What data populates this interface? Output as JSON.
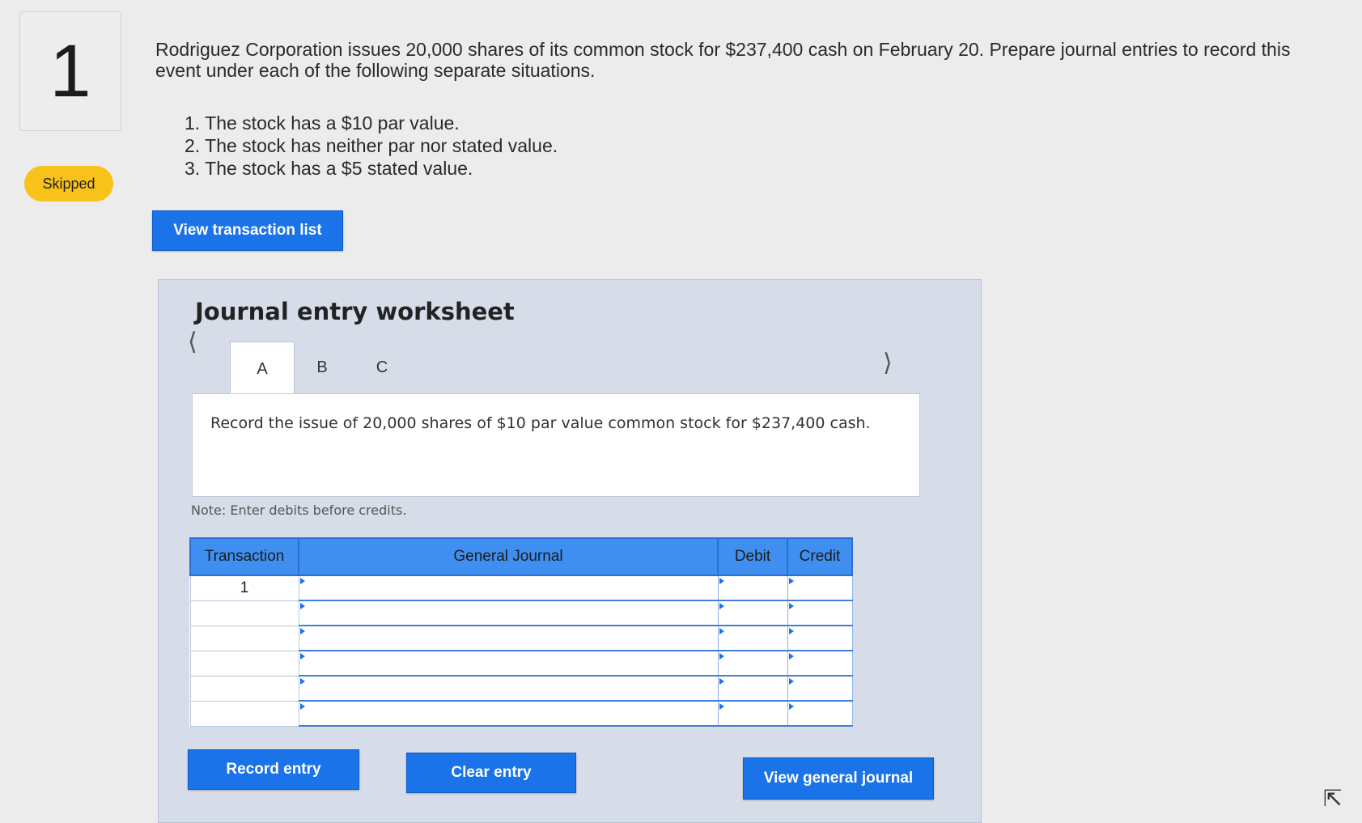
{
  "question": {
    "number": "1",
    "status": "Skipped",
    "prompt": "Rodriguez Corporation issues 20,000 shares of its common stock for $237,400 cash on February 20. Prepare journal entries to record this event under each of the following separate situations.",
    "situations": [
      "The stock has a $10 par value.",
      "The stock has neither par nor stated value.",
      "The stock has a $5 stated value."
    ]
  },
  "buttons": {
    "view_transaction_list": "View transaction list",
    "record_entry": "Record entry",
    "clear_entry": "Clear entry",
    "view_general_journal": "View general journal"
  },
  "worksheet": {
    "title": "Journal entry worksheet",
    "tabs": [
      "A",
      "B",
      "C"
    ],
    "active_tab": "A",
    "instruction": "Record the issue of 20,000 shares of $10 par value common stock for $237,400 cash.",
    "note": "Note: Enter debits before credits.",
    "table": {
      "headers": [
        "Transaction",
        "General Journal",
        "Debit",
        "Credit"
      ],
      "rows": [
        {
          "transaction": "1",
          "account": "",
          "debit": "",
          "credit": ""
        },
        {
          "transaction": "",
          "account": "",
          "debit": "",
          "credit": ""
        },
        {
          "transaction": "",
          "account": "",
          "debit": "",
          "credit": ""
        },
        {
          "transaction": "",
          "account": "",
          "debit": "",
          "credit": ""
        },
        {
          "transaction": "",
          "account": "",
          "debit": "",
          "credit": ""
        },
        {
          "transaction": "",
          "account": "",
          "debit": "",
          "credit": ""
        }
      ]
    }
  },
  "colors": {
    "primary_button": "#1a73e8",
    "badge": "#f7c31a",
    "table_header": "#3f8ff0",
    "worksheet_bg": "#d6dde8"
  }
}
